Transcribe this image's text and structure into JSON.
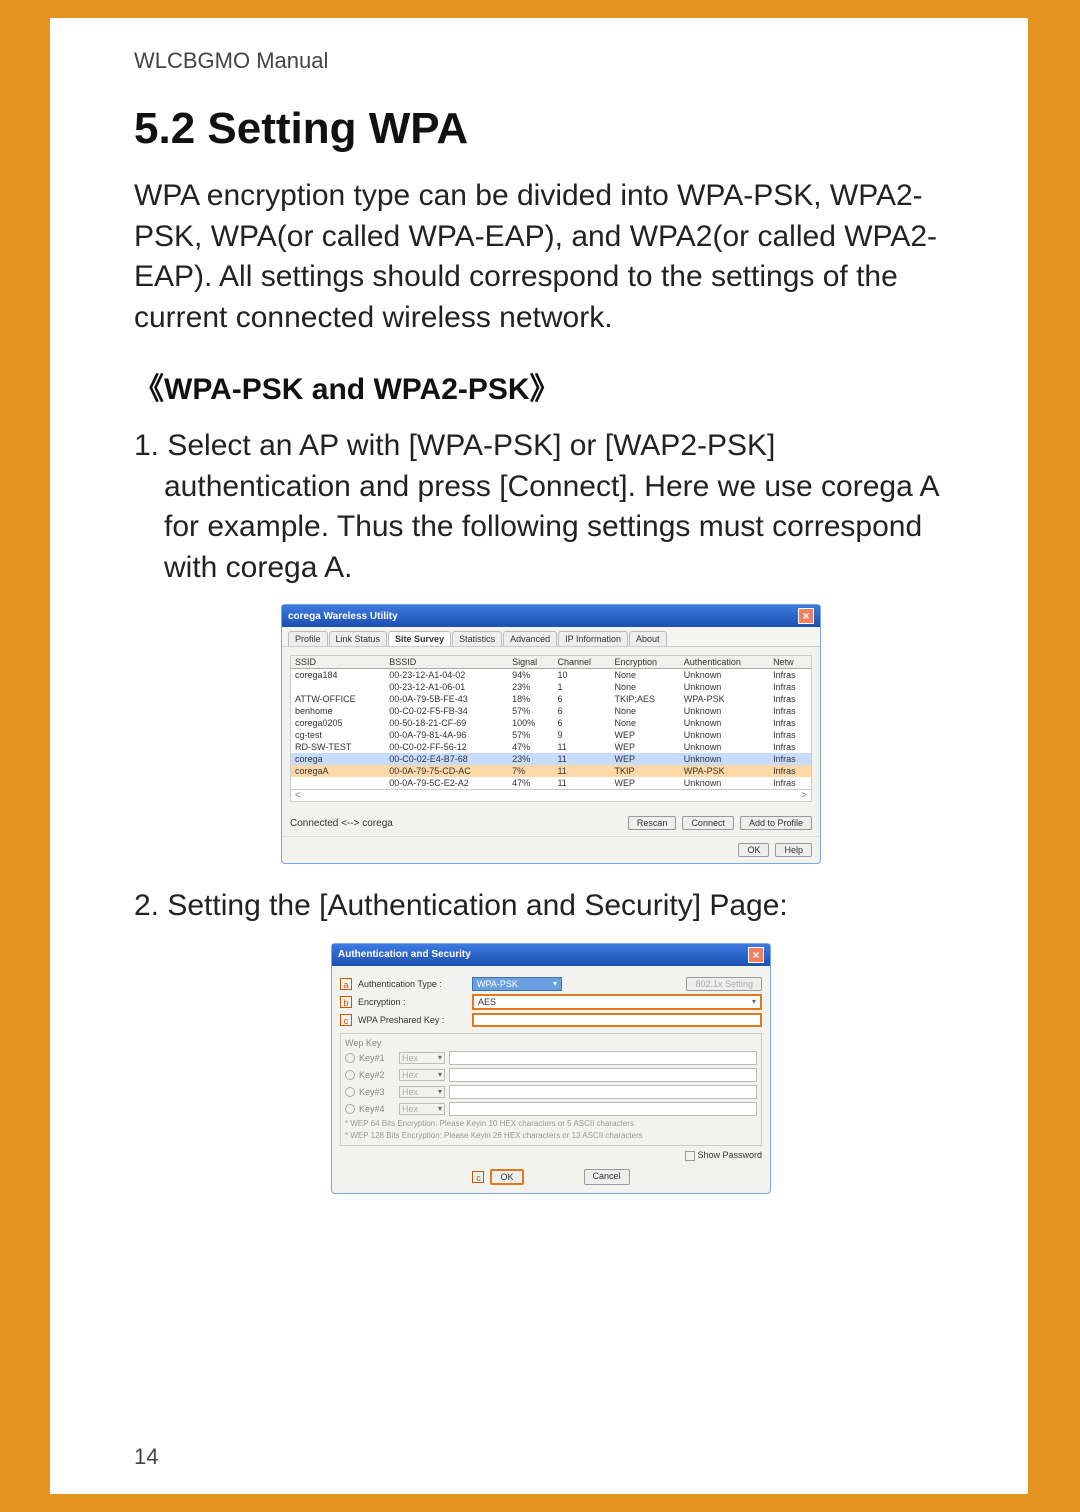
{
  "header": "WLCBGMO  Manual",
  "section_title": "5.2 Setting WPA",
  "intro": "WPA encryption type can be divided into WPA-PSK, WPA2-PSK, WPA(or called WPA-EAP), and WPA2(or called WPA2-EAP). All settings should correspond to the settings of the current connected wireless network.",
  "subhead": "《WPA-PSK and WPA2-PSK》",
  "step1": "1.  Select an AP with [WPA-PSK] or [WAP2-PSK] authentication and press [Connect]. Here we use corega A for example. Thus the following settings must correspond with corega A.",
  "step2": "2. Setting the [Authentication and Security] Page:",
  "page_number": "14",
  "fig1": {
    "title": "corega Wareless Utility",
    "closeX": "×",
    "tabs": [
      "Profile",
      "Link Status",
      "Site Survey",
      "Statistics",
      "Advanced",
      "IP Information",
      "About"
    ],
    "active_tab": 2,
    "columns": [
      "SSID",
      "BSSID",
      "Signal",
      "Channel",
      "Encryption",
      "Authentication",
      "Netw"
    ],
    "rows": [
      {
        "sel": "",
        "ssid": "corega184",
        "bssid": "00-23-12-A1-04-02",
        "signal": "94%",
        "ch": "10",
        "enc": "None",
        "auth": "Unknown",
        "net": "Infras"
      },
      {
        "sel": "",
        "ssid": "",
        "bssid": "00-23-12-A1-06-01",
        "signal": "23%",
        "ch": "1",
        "enc": "None",
        "auth": "Unknown",
        "net": "Infras"
      },
      {
        "sel": "",
        "ssid": "ATTW-OFFICE",
        "bssid": "00-0A-79-5B-FE-43",
        "signal": "18%",
        "ch": "6",
        "enc": "TKIP;AES",
        "auth": "WPA-PSK",
        "net": "Infras"
      },
      {
        "sel": "",
        "ssid": "benhome",
        "bssid": "00-C0-02-F5-FB-34",
        "signal": "57%",
        "ch": "6",
        "enc": "None",
        "auth": "Unknown",
        "net": "Infras"
      },
      {
        "sel": "",
        "ssid": "corega0205",
        "bssid": "00-50-18-21-CF-69",
        "signal": "100%",
        "ch": "6",
        "enc": "None",
        "auth": "Unknown",
        "net": "Infras"
      },
      {
        "sel": "",
        "ssid": "cg-test",
        "bssid": "00-0A-79-81-4A-96",
        "signal": "57%",
        "ch": "9",
        "enc": "WEP",
        "auth": "Unknown",
        "net": "Infras"
      },
      {
        "sel": "",
        "ssid": "RD-SW-TEST",
        "bssid": "00-C0-02-FF-56-12",
        "signal": "47%",
        "ch": "11",
        "enc": "WEP",
        "auth": "Unknown",
        "net": "Infras"
      },
      {
        "sel": "hl",
        "ssid": "corega",
        "bssid": "00-C0-02-E4-B7-68",
        "signal": "23%",
        "ch": "11",
        "enc": "WEP",
        "auth": "Unknown",
        "net": "Infras"
      },
      {
        "sel": "sel",
        "ssid": "coregaA",
        "bssid": "00-0A-79-75-CD-AC",
        "signal": "7%",
        "ch": "11",
        "enc": "TKIP",
        "auth": "WPA-PSK",
        "net": "Infras"
      },
      {
        "sel": "",
        "ssid": "",
        "bssid": "00-0A-79-5C-E2-A2",
        "signal": "47%",
        "ch": "11",
        "enc": "WEP",
        "auth": "Unknown",
        "net": "Infras"
      }
    ],
    "status": "Connected <--> corega",
    "btn_rescan": "Rescan",
    "btn_connect": "Connect",
    "btn_add": "Add to Profile",
    "btn_ok": "OK",
    "btn_help": "Help"
  },
  "fig2": {
    "title": "Authentication and Security",
    "closeX": "×",
    "marker_a": "a",
    "marker_b": "b",
    "marker_c": "c",
    "marker_c2": "c",
    "lbl_auth": "Authentication Type :",
    "val_auth": "WPA-PSK",
    "btn_8021x": "802.1x Setting",
    "lbl_enc": "Encryption :",
    "val_enc": "AES",
    "lbl_psk": "WPA Preshared Key :",
    "wep_title": "Wep Key",
    "wep_keys": [
      "Key#1",
      "Key#2",
      "Key#3",
      "Key#4"
    ],
    "wep_hex": "Hex",
    "wep_note1": "* WEP 64 Bits Encryption: Please Keyin 10 HEX characters or 5 ASCII characters",
    "wep_note2": "* WEP 128 Bits Encryption: Please Keyin 26 HEX characters or 13 ASCII characters",
    "show_pw": "Show Password",
    "btn_ok": "OK",
    "btn_cancel": "Cancel"
  }
}
